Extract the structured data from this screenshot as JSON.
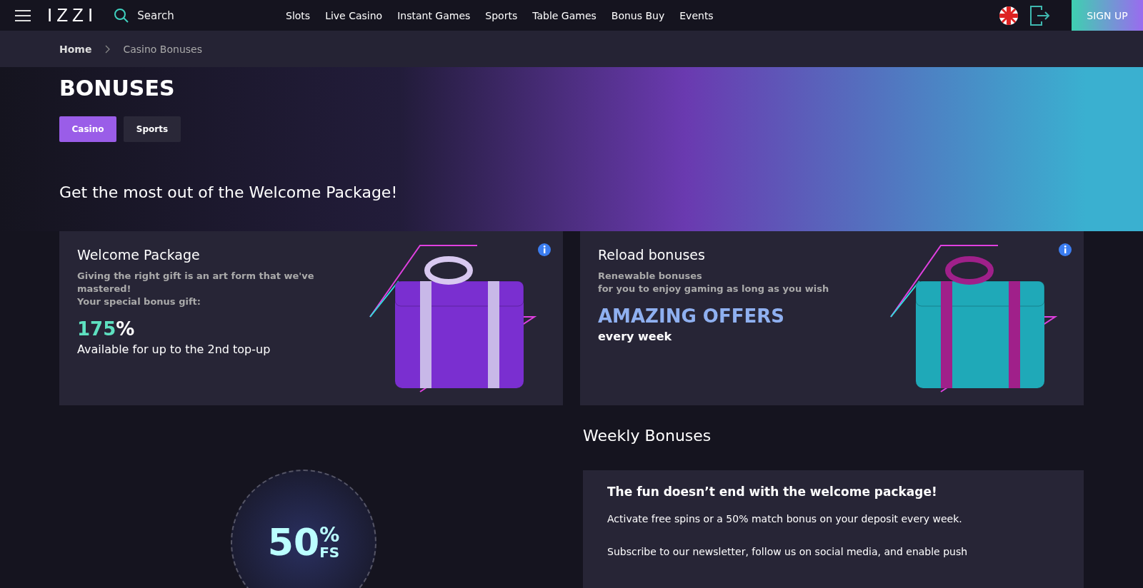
{
  "header": {
    "logo": "IZZI",
    "search": {
      "placeholder": "Search"
    },
    "nav": [
      "Slots",
      "Live Casino",
      "Instant Games",
      "Sports",
      "Table Games",
      "Bonus Buy",
      "Events"
    ],
    "signup": "SIGN UP"
  },
  "breadcrumb": [
    "Home",
    "Casino Bonuses"
  ],
  "title": "BONUSES",
  "tabs": [
    {
      "label": "Casino",
      "selected": true
    },
    {
      "label": "Sports",
      "selected": false
    }
  ],
  "subtitle": "Get the most out of the Welcome Package!",
  "cards": [
    {
      "kind": "welcome",
      "title": "Welcome Package",
      "lines": [
        "Giving the right gift is an art form that we've mastered!",
        "Your special bonus gift:"
      ],
      "amount": "175",
      "unit": "%",
      "footer": "Available for up to the 2nd top-up"
    },
    {
      "kind": "reload",
      "title": "Reload bonuses",
      "lines": [
        "Renewable bonuses",
        "for you to enjoy gaming as long as you wish"
      ],
      "headline": "AMAZING OFFERS",
      "footer": "every week"
    }
  ],
  "weekly": {
    "title": "Weekly Bonuses",
    "promo": {
      "value": "50",
      "percent": "%",
      "unit": "FS"
    },
    "heading": "The fun doesn’t end with the welcome package!",
    "paragraphs": [
      "Activate free spins or a 50% match bonus on your deposit every week.",
      "Subscribe to our newsletter, follow us on social media, and enable push"
    ]
  }
}
